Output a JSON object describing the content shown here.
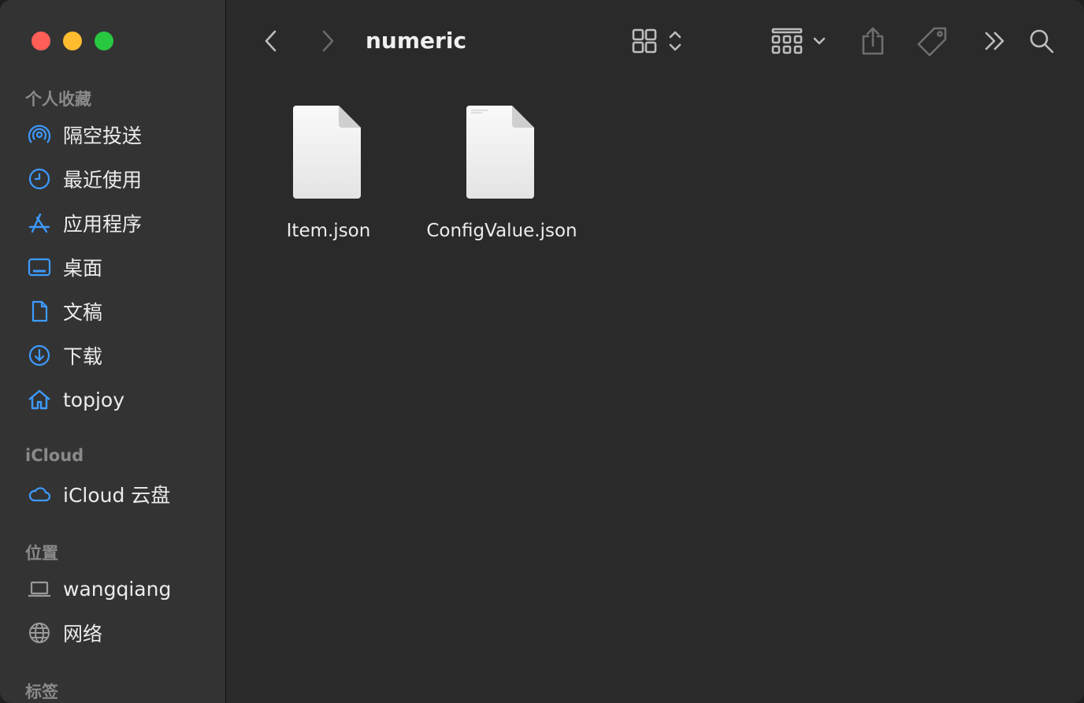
{
  "toolbar": {
    "title": "numeric"
  },
  "sidebar": {
    "favorites_title": "个人收藏",
    "favorites": [
      {
        "label": "隔空投送",
        "icon": "airdrop-icon"
      },
      {
        "label": "最近使用",
        "icon": "clock-icon"
      },
      {
        "label": "应用程序",
        "icon": "applications-icon"
      },
      {
        "label": "桌面",
        "icon": "desktop-icon"
      },
      {
        "label": "文稿",
        "icon": "document-icon"
      },
      {
        "label": "下载",
        "icon": "download-icon"
      },
      {
        "label": "topjoy",
        "icon": "home-icon"
      }
    ],
    "icloud_title": "iCloud",
    "icloud": [
      {
        "label": "iCloud 云盘",
        "icon": "cloud-icon"
      }
    ],
    "locations_title": "位置",
    "locations": [
      {
        "label": "wangqiang",
        "icon": "laptop-icon"
      },
      {
        "label": "网络",
        "icon": "globe-icon"
      }
    ],
    "tags_title": "标签"
  },
  "files": [
    {
      "name": "Item.json",
      "icon": "json-file-icon"
    },
    {
      "name": "ConfigValue.json",
      "icon": "json-file-icon"
    }
  ],
  "colors": {
    "accent": "#3d9bff",
    "sidebar_bg": "#333334",
    "main_bg": "#2a2a2a"
  }
}
